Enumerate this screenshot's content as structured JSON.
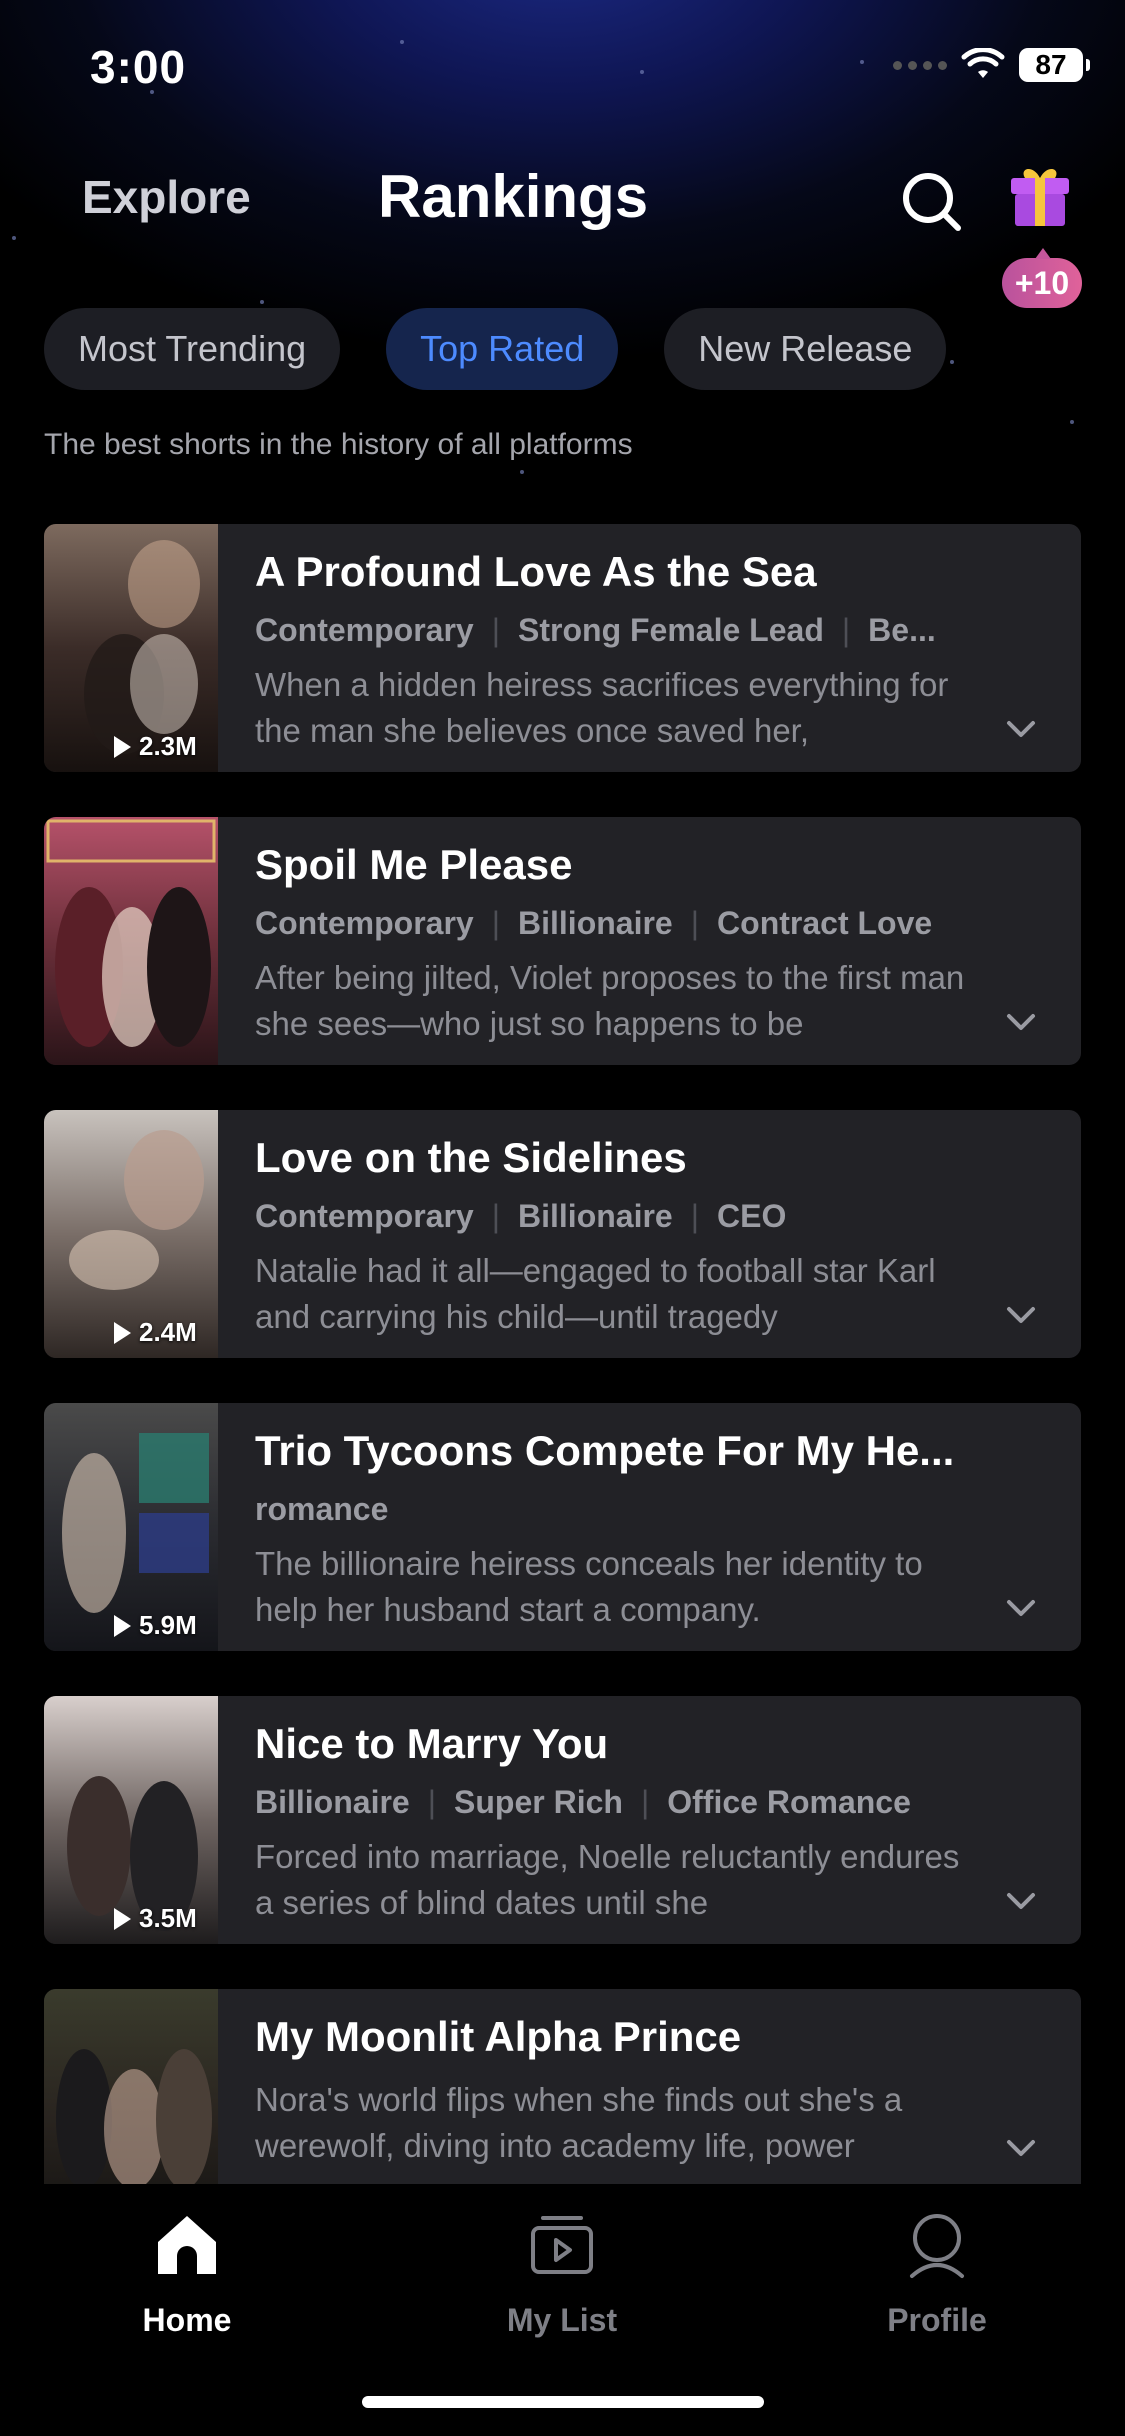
{
  "status_bar": {
    "time": "3:00",
    "battery": "87"
  },
  "nav": {
    "explore": "Explore",
    "rankings": "Rankings",
    "gift_badge": "+10"
  },
  "tabs": [
    {
      "label": "Most Trending",
      "active": false
    },
    {
      "label": "Top Rated",
      "active": true
    },
    {
      "label": "New Release",
      "active": false
    }
  ],
  "subtitle": "The best shorts in the history of all platforms",
  "items": [
    {
      "title": "A Profound Love As the Sea",
      "tags": [
        "Contemporary",
        "Strong Female Lead",
        "Be..."
      ],
      "description": "When a hidden heiress sacrifices everything for the man she believes once saved her,",
      "views": "2.3M"
    },
    {
      "title": "Spoil Me Please",
      "tags": [
        "Contemporary",
        "Billionaire",
        "Contract Love"
      ],
      "description": "After being jilted, Violet proposes to the first man she sees—who just so happens to be",
      "views": ""
    },
    {
      "title": "Love on the Sidelines",
      "tags": [
        "Contemporary",
        "Billionaire",
        "CEO"
      ],
      "description": "Natalie had it all—engaged to football star Karl and carrying his child—until tragedy",
      "views": "2.4M"
    },
    {
      "title": "Trio Tycoons Compete For My He...",
      "tags": [
        "romance"
      ],
      "description": "The billionaire heiress conceals her identity to help her husband start a company.",
      "views": "5.9M"
    },
    {
      "title": "Nice to Marry You",
      "tags": [
        "Billionaire",
        "Super Rich",
        "Office Romance"
      ],
      "description": "Forced into marriage, Noelle reluctantly endures a series of blind dates until she",
      "views": "3.5M"
    },
    {
      "title": "My Moonlit Alpha Prince",
      "tags": [],
      "description": "Nora's world flips when she finds out she's a werewolf, diving into academy life, power",
      "views": ""
    }
  ],
  "tabbar": [
    {
      "label": "Home",
      "icon": "home-icon",
      "active": true
    },
    {
      "label": "My List",
      "icon": "my-list-icon",
      "active": false
    },
    {
      "label": "Profile",
      "icon": "profile-icon",
      "active": false
    }
  ],
  "colors": {
    "active_tab_text": "#4d8bff",
    "active_tab_bg": "#15254d",
    "card_bg": "#222226",
    "badge": "#d85d9b"
  }
}
